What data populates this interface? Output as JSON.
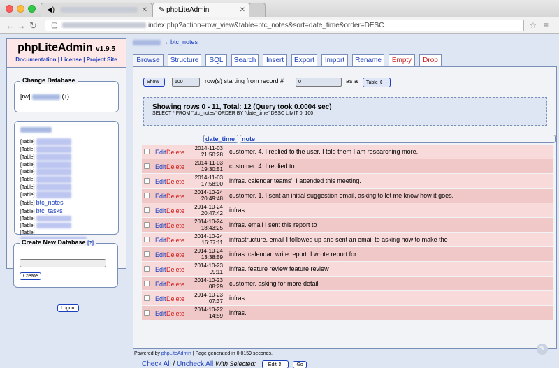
{
  "browser": {
    "tab1_title": "",
    "tab2_title": "phpLiteAdmin",
    "url_prefix": "",
    "url_path": "index.php?action=row_view&table=btc_notes&sort=date_time&order=DESC"
  },
  "sidebar": {
    "app_name": "phpLiteAdmin",
    "version": "v1.9.5",
    "links": [
      "Documentation",
      "License",
      "Project Site"
    ],
    "change_db_legend": "Change Database",
    "db_prefix": "[rw]",
    "db_suffix": "(↓)",
    "table_prefix": "[Table]",
    "visible_tables": [
      "btc_notes",
      "btc_tasks"
    ],
    "create_db_legend": "Create New Database",
    "create_help": "[?]",
    "create_button": "Create",
    "logout_button": "Logout"
  },
  "main": {
    "breadcrumb_arrow": "→",
    "breadcrumb_table": "btc_notes",
    "tabs": [
      {
        "label": "Browse"
      },
      {
        "label": "Structure"
      },
      {
        "label": "SQL"
      },
      {
        "label": "Search"
      },
      {
        "label": "Insert"
      },
      {
        "label": "Export"
      },
      {
        "label": "Import"
      },
      {
        "label": "Rename"
      },
      {
        "label": "Empty"
      },
      {
        "label": "Drop"
      }
    ],
    "show_button": "Show :",
    "row_count": "100",
    "rows_text": "row(s) starting from record #",
    "start_record": "0",
    "as_a_text": "as a",
    "view_select": "Table",
    "summary_title": "Showing rows 0 - 11, Total: 12 (Query took 0.0004 sec)",
    "summary_sql": "SELECT * FROM \"btc_notes\" ORDER BY \"date_time\" DESC LIMIT 0, 100",
    "col_date_time": "date_time ↓",
    "col_note": "note",
    "edit_label": "Edit",
    "delete_label": "Delete",
    "rows": [
      {
        "date": "2014-11-03",
        "time": "21:50:28",
        "note": "customer. 4. I replied to the user. I told them I am researching more."
      },
      {
        "date": "2014-11-03",
        "time": "19:30:51",
        "note": "customer. 4. I replied to"
      },
      {
        "date": "2014-11-03",
        "time": "17:58:00",
        "note": "infras. calendar teams'. I attended this meeting."
      },
      {
        "date": "2014-10-24",
        "time": "20:49:48",
        "note": "customer. 1. I sent an initial suggestion email, asking to let me know how it goes."
      },
      {
        "date": "2014-10-24",
        "time": "20:47:42",
        "note": "infras."
      },
      {
        "date": "2014-10-24",
        "time": "18:43:25",
        "note": "infras. email I sent this report to"
      },
      {
        "date": "2014-10-24",
        "time": "16:37:11",
        "note": "infrastructure. email I followed up and sent an email to asking how to make the"
      },
      {
        "date": "2014-10-24",
        "time": "13:38:59",
        "note": "infras. calendar. write report. I wrote report for"
      },
      {
        "date": "2014-10-23",
        "time": "09:11",
        "note": "infras. feature review feature review"
      },
      {
        "date": "2014-10-23",
        "time": "08:29",
        "note": "customer. asking for more detail"
      },
      {
        "date": "2014-10-23",
        "time": "07:37",
        "note": "infras."
      },
      {
        "date": "2014-10-22",
        "time": "14:59",
        "note": "infras."
      }
    ],
    "check_all": "Check All",
    "slash": "/",
    "uncheck_all": "Uncheck All",
    "with_selected": "With Selected:",
    "bulk_select": "Edit",
    "go_button": "Go"
  },
  "footer": {
    "powered_by": "Powered by",
    "app_link": "phpLiteAdmin",
    "generated": "| Page generated in 0.0159 seconds."
  }
}
